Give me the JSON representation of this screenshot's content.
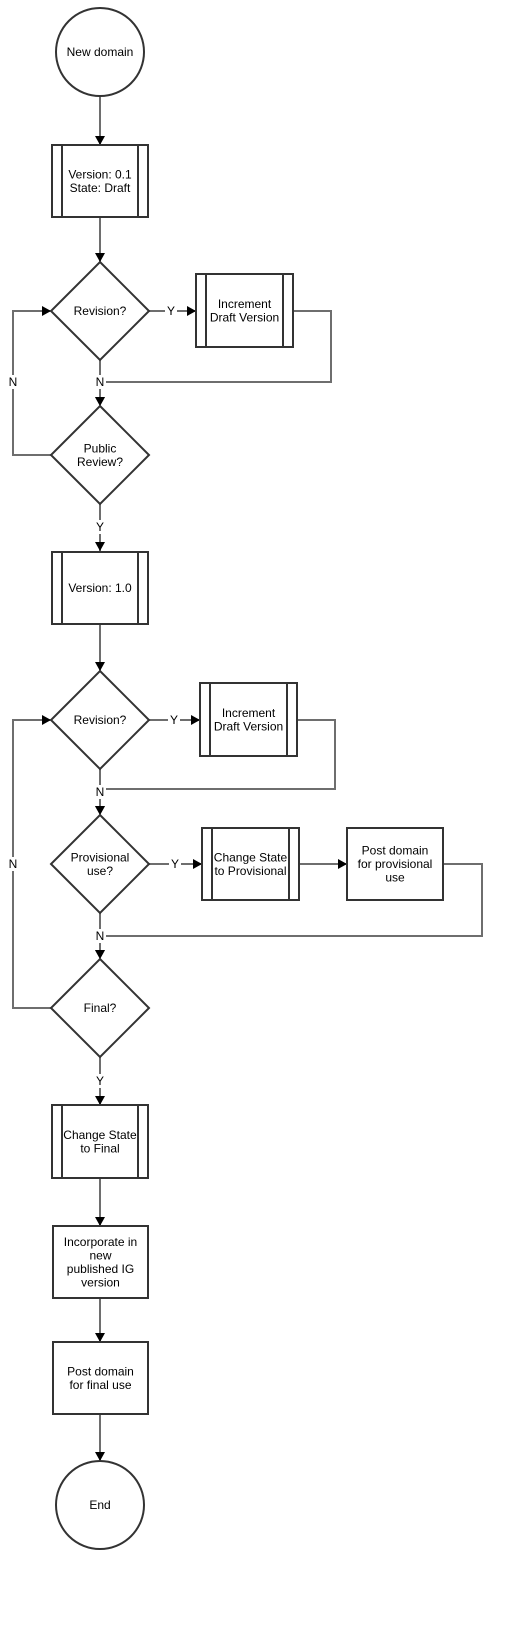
{
  "diagram": {
    "type": "flowchart",
    "nodes": [
      {
        "id": "new-domain",
        "shape": "circle",
        "lines": [
          "New domain"
        ]
      },
      {
        "id": "version-01",
        "shape": "subprocess",
        "lines": [
          "Version: 0.1",
          "State: Draft"
        ]
      },
      {
        "id": "revision-1",
        "shape": "decision",
        "lines": [
          "Revision?"
        ]
      },
      {
        "id": "increment-1",
        "shape": "subprocess",
        "lines": [
          "Increment",
          "Draft Version"
        ]
      },
      {
        "id": "public-review",
        "shape": "decision",
        "lines": [
          "Public",
          "Review?"
        ]
      },
      {
        "id": "version-10",
        "shape": "subprocess",
        "lines": [
          "Version: 1.0"
        ]
      },
      {
        "id": "revision-2",
        "shape": "decision",
        "lines": [
          "Revision?"
        ]
      },
      {
        "id": "increment-2",
        "shape": "subprocess",
        "lines": [
          "Increment",
          "Draft Version"
        ]
      },
      {
        "id": "provisional-use",
        "shape": "decision",
        "lines": [
          "Provisional",
          "use?"
        ]
      },
      {
        "id": "change-provisional",
        "shape": "subprocess",
        "lines": [
          "Change State",
          "to Provisional"
        ]
      },
      {
        "id": "post-provisional",
        "shape": "process",
        "lines": [
          "Post domain",
          "for provisional",
          "use"
        ]
      },
      {
        "id": "final",
        "shape": "decision",
        "lines": [
          "Final?"
        ]
      },
      {
        "id": "change-final",
        "shape": "subprocess",
        "lines": [
          "Change State",
          "to Final"
        ]
      },
      {
        "id": "incorporate",
        "shape": "process",
        "lines": [
          "Incorporate in",
          "new",
          "published IG",
          "version"
        ]
      },
      {
        "id": "post-final",
        "shape": "process",
        "lines": [
          "Post domain",
          "for final use"
        ]
      },
      {
        "id": "end",
        "shape": "circle",
        "lines": [
          "End"
        ]
      }
    ],
    "edges": [
      {
        "from": "new-domain",
        "to": "version-01",
        "label": ""
      },
      {
        "from": "version-01",
        "to": "revision-1",
        "label": ""
      },
      {
        "from": "revision-1",
        "to": "increment-1",
        "label": "Y"
      },
      {
        "from": "increment-1",
        "to": "public-review",
        "label": ""
      },
      {
        "from": "revision-1",
        "to": "public-review",
        "label": "N"
      },
      {
        "from": "public-review",
        "to": "revision-1",
        "label": "N"
      },
      {
        "from": "public-review",
        "to": "version-10",
        "label": "Y"
      },
      {
        "from": "version-10",
        "to": "revision-2",
        "label": ""
      },
      {
        "from": "revision-2",
        "to": "increment-2",
        "label": "Y"
      },
      {
        "from": "increment-2",
        "to": "provisional-use",
        "label": ""
      },
      {
        "from": "revision-2",
        "to": "provisional-use",
        "label": "N"
      },
      {
        "from": "provisional-use",
        "to": "change-provisional",
        "label": "Y"
      },
      {
        "from": "change-provisional",
        "to": "post-provisional",
        "label": ""
      },
      {
        "from": "post-provisional",
        "to": "final",
        "label": ""
      },
      {
        "from": "provisional-use",
        "to": "final",
        "label": "N"
      },
      {
        "from": "final",
        "to": "revision-2",
        "label": "N"
      },
      {
        "from": "final",
        "to": "change-final",
        "label": "Y"
      },
      {
        "from": "change-final",
        "to": "incorporate",
        "label": ""
      },
      {
        "from": "incorporate",
        "to": "post-final",
        "label": ""
      },
      {
        "from": "post-final",
        "to": "end",
        "label": ""
      }
    ]
  }
}
